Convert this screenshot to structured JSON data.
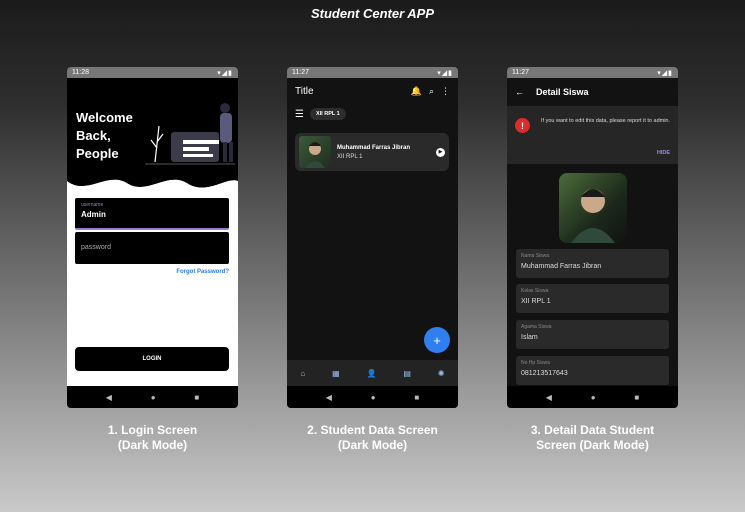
{
  "app_title": "Student Center APP",
  "screens": [
    {
      "caption_line1": "1. Login Screen",
      "caption_line2": "(Dark Mode)",
      "status_time": "11:28",
      "welcome": "Welcome Back, People",
      "username_label": "username",
      "username_value": "Admin",
      "password_placeholder": "password",
      "forgot_label": "Forgot Password?",
      "login_label": "LOGIN"
    },
    {
      "caption_line1": "2. Student Data Screen",
      "caption_line2": "(Dark Mode)",
      "status_time": "11:27",
      "title": "Title",
      "chip_label": "XII RPL 1",
      "student_name": "Muhammad Farras Jibran",
      "student_class": "XII RPL 1",
      "fab_label": "+"
    },
    {
      "caption_line1": "3. Detail Data Student",
      "caption_line2": "Screen (Dark Mode)",
      "status_time": "11:27",
      "title": "Detail Siswa",
      "banner_text": "If you want to edit this data, please report it to admin.",
      "hide_label": "HIDE",
      "fields": [
        {
          "label": "Nama Siswa",
          "value": "Muhammad Farras Jibran"
        },
        {
          "label": "Kelas Siswa",
          "value": "XII RPL 1"
        },
        {
          "label": "Agama Siswa",
          "value": "Islam"
        },
        {
          "label": "No Hp Siswa",
          "value": "081213517643"
        }
      ]
    }
  ],
  "icons": {
    "status": "wifi-signal-battery",
    "nav_back": "◀",
    "nav_home": "●",
    "nav_recent": "■"
  },
  "colors": {
    "accent_blue": "#2f7ff0",
    "accent_purple": "#9a7bd6",
    "warn_red": "#e02929"
  }
}
